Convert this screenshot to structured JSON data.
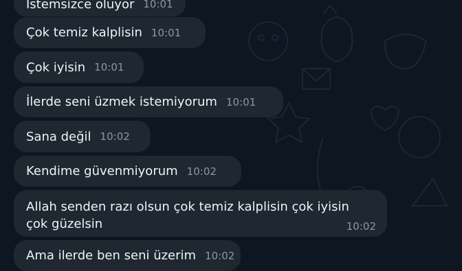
{
  "messages": [
    {
      "text": "İstemsizce oluyor",
      "time": "10:01"
    },
    {
      "text": "Çok temiz kalplisin",
      "time": "10:01"
    },
    {
      "text": "Çok iyisin",
      "time": "10:01"
    },
    {
      "text": "İlerde seni üzmek istemiyorum",
      "time": "10:01"
    },
    {
      "text": "Sana değil",
      "time": "10:02"
    },
    {
      "text": "Kendime güvenmiyorum",
      "time": "10:02"
    },
    {
      "text_line1": "Allah senden razı olsun çok temiz kalplisin çok iyisin",
      "text_line2": "çok güzelsin",
      "time": "10:02"
    },
    {
      "text": "Ama ilerde ben seni üzerim",
      "time": "10:02"
    }
  ],
  "colors": {
    "background": "#0e1621",
    "bubble": "#1f2731",
    "text": "#f2f3f5",
    "time": "#8b97a5"
  }
}
